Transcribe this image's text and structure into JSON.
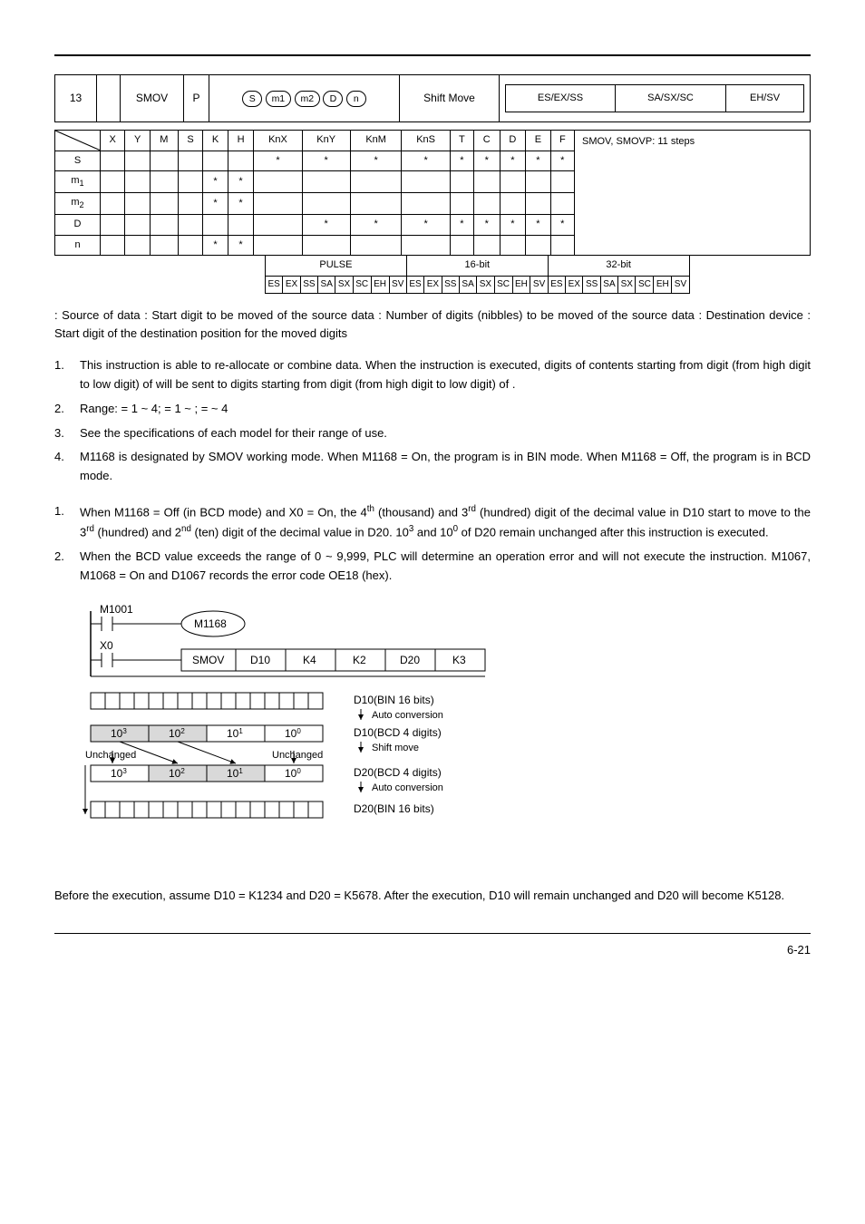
{
  "api_row": {
    "api_num": "13",
    "mnemonic": "SMOV",
    "p": "P",
    "operands": [
      "S",
      "m1",
      "m2",
      "D",
      "n"
    ],
    "function": "Shift Move",
    "controllers": [
      "ES/EX/SS",
      "SA/SX/SC",
      "EH/SV"
    ]
  },
  "op_cols": [
    "X",
    "Y",
    "M",
    "S",
    "K",
    "H",
    "KnX",
    "KnY",
    "KnM",
    "KnS",
    "T",
    "C",
    "D",
    "E",
    "F"
  ],
  "op_rows": [
    {
      "lbl": "S",
      "cells": [
        "",
        "",
        "",
        "",
        "",
        "",
        "*",
        "*",
        "*",
        "*",
        "*",
        "*",
        "*",
        "*",
        "*"
      ]
    },
    {
      "lbl": "m1",
      "cells": [
        "",
        "",
        "",
        "",
        "*",
        "*",
        "",
        "",
        "",
        "",
        "",
        "",
        "",
        "",
        ""
      ]
    },
    {
      "lbl": "m2",
      "cells": [
        "",
        "",
        "",
        "",
        "*",
        "*",
        "",
        "",
        "",
        "",
        "",
        "",
        "",
        "",
        ""
      ]
    },
    {
      "lbl": "D",
      "cells": [
        "",
        "",
        "",
        "",
        "",
        "",
        "",
        "*",
        "*",
        "*",
        "*",
        "*",
        "*",
        "*",
        "*"
      ]
    },
    {
      "lbl": "n",
      "cells": [
        "",
        "",
        "",
        "",
        "*",
        "*",
        "",
        "",
        "",
        "",
        "",
        "",
        "",
        "",
        ""
      ]
    }
  ],
  "steps_text": "SMOV, SMOVP: 11 steps",
  "mode_headers": [
    "PULSE",
    "16-bit",
    "32-bit"
  ],
  "mode_cells": [
    "ES",
    "EX",
    "SS",
    "SA",
    "SX",
    "SC",
    "EH",
    "SV",
    "ES",
    "EX",
    "SS",
    "SA",
    "SX",
    "SC",
    "EH",
    "SV",
    "ES",
    "EX",
    "SS",
    "SA",
    "SX",
    "SC",
    "EH",
    "SV"
  ],
  "operands_desc": " : Source of data       : Start digit to be moved of the source data       : Number of digits (nibbles) to be moved of the source data       : Destination device       : Start digit of the destination position for the moved digits",
  "explanations": [
    "This instruction is able to re-allocate or combine data. When the instruction is executed,    digits of contents starting from digit    (from high digit to low digit) of    will be sent to    digits starting from digit    (from high digit to low digit) of    .",
    "Range:    = 1 ~ 4;    = 1 ~    ;    =    ~ 4",
    "See the specifications of each model for their range of use.",
    "M1168 is designated by SMOV working mode. When M1168 = On, the program is in BIN mode. When M1168 = Off, the program is in BCD mode."
  ],
  "examples": [
    "When M1168 = Off (in BCD mode) and X0 = On, the 4<sup>th</sup> (thousand) and 3<sup>rd</sup> (hundred) digit of the decimal value in D10 start to move to the 3<sup>rd</sup> (hundred) and 2<sup>nd</sup> (ten) digit of the decimal value in D20. 10<sup>3</sup> and 10<sup>0</sup> of D20 remain unchanged after this instruction is executed.",
    "When the BCD value exceeds the range of 0 ~ 9,999, PLC will determine an operation error and will not execute the instruction. M1067, M1068 = On and D1067 records the error code OE18 (hex)."
  ],
  "ladder": {
    "m1001": "M1001",
    "m1168": "M1168",
    "x0": "X0",
    "instr": [
      "SMOV",
      "D10",
      "K4",
      "K2",
      "D20",
      "K3"
    ]
  },
  "flow": {
    "pow": [
      "10",
      "10",
      "10",
      "10",
      "10",
      "10",
      "10",
      "10"
    ],
    "exp": [
      "3",
      "2",
      "1",
      "0",
      "3",
      "2",
      "1",
      "0"
    ],
    "unchanged": "Unchanged",
    "r1": "D10(BIN 16 bits)",
    "r2": "Auto conversion",
    "r3": "D10(BCD 4 digits)",
    "r4": "Shift move",
    "r5": "D20(BCD 4 digits)",
    "r6": "Auto conversion",
    "r7": "D20(BIN 16 bits)"
  },
  "after_text": "Before the execution, assume D10 = K1234 and D20 = K5678. After the execution, D10 will remain unchanged and D20 will become K5128.",
  "page_num": "6-21"
}
